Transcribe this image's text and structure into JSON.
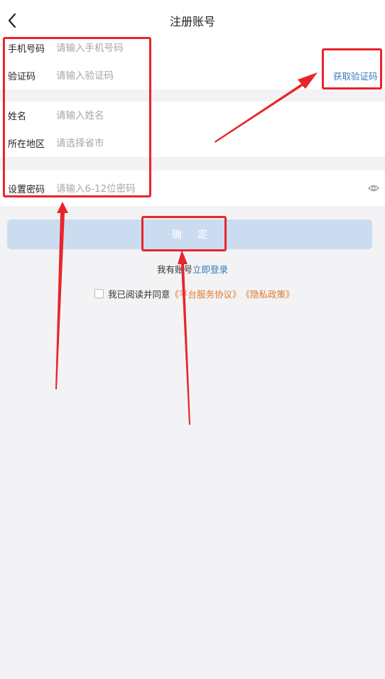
{
  "header": {
    "title": "注册账号",
    "back_icon": "chevron-left-icon"
  },
  "form": {
    "phone": {
      "label": "手机号码",
      "placeholder": "请输入手机号码"
    },
    "code": {
      "label": "验证码",
      "placeholder": "请输入验证码",
      "get_code_label": "获取验证码"
    },
    "name": {
      "label": "姓名",
      "placeholder": "请输入姓名"
    },
    "region": {
      "label": "所在地区",
      "placeholder": "请选择省市"
    },
    "password": {
      "label": "设置密码",
      "placeholder": "请输入6-12位密码",
      "toggle_icon": "eye-icon"
    }
  },
  "confirm_label": "确定",
  "login": {
    "prefix": "我有账号",
    "link": "立即登录"
  },
  "agreement": {
    "prefix": "我已阅读并同意",
    "terms": "《平台服务协议》",
    "privacy": "《隐私政策》"
  },
  "colors": {
    "annotation": "#e8252b",
    "link_blue": "#3a78b8",
    "link_orange": "#e07a2c",
    "button_bg": "#ccdcf0"
  }
}
